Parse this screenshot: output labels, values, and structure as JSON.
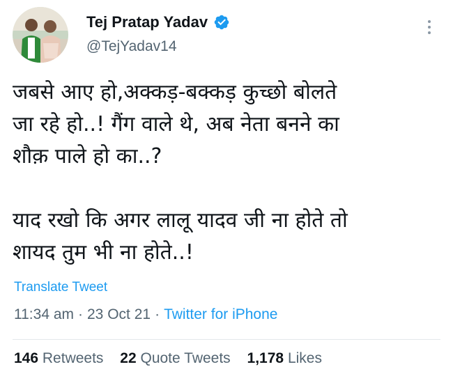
{
  "author": {
    "display_name": "Tej Pratap Yadav",
    "handle": "@TejYadav14",
    "verified": true,
    "verified_color": "#1d9bf0"
  },
  "tweet": {
    "text": "जबसे आए हो,अक्कड़-बक्कड़ कुच्छो बोलते\nजा रहे हो..! गैंग वाले थे, अब नेता बनने का\nशौक़ पाले हो का..?\n\nयाद रखो कि अगर लालू यादव जी ना होते तो\nशायद तुम भी ना होते..!",
    "translate_label": "Translate Tweet",
    "time": "11:34 am",
    "date": "23 Oct 21",
    "separator": "·",
    "source": "Twitter for iPhone"
  },
  "stats": {
    "retweets_count": "146",
    "retweets_label": "Retweets",
    "quotes_count": "22",
    "quotes_label": "Quote Tweets",
    "likes_count": "1,178",
    "likes_label": "Likes"
  },
  "colors": {
    "link": "#1d9bf0",
    "secondary_text": "#536471",
    "primary_text": "#0f1419"
  },
  "icons": {
    "more": "more-options-icon",
    "verified": "verified-badge-icon"
  }
}
